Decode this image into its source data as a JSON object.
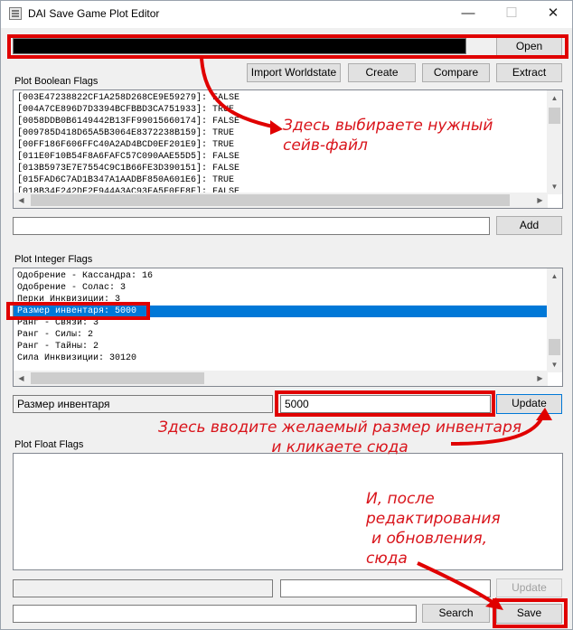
{
  "window": {
    "title": "DAI Save Game Plot Editor",
    "minimize": "—",
    "maximize": "☐",
    "close": "✕"
  },
  "file": {
    "path": "",
    "open_label": "Open"
  },
  "toolbar": {
    "import_label": "Import Worldstate",
    "create_label": "Create",
    "compare_label": "Compare",
    "extract_label": "Extract"
  },
  "boolean": {
    "label": "Plot Boolean Flags",
    "rows": [
      "[003E47238822CF1A258D268CE9E59279]: FALSE",
      "[004A7CE896D7D3394BCFBBD3CA751933]: TRUE",
      "[0058DDB0B6149442B13FF99015660174]: FALSE",
      "[009785D418D65A5B3064E8372238B159]: TRUE",
      "[00FF186F606FFC40A2AD4BCD0EF201E9]: TRUE",
      "[011E0F10B54F8A6FAFC57C090AAE55D5]: FALSE",
      "[013B5973E7E7554C9C1B66FE3D390151]: FALSE",
      "[015FAD6C7AD1B347A1AADBF850A601E6]: TRUE",
      "[018B34F242DF2E944A3AC93FA5F0FF8F]: FALSE"
    ],
    "input_value": "",
    "add_label": "Add"
  },
  "integer": {
    "label": "Plot Integer Flags",
    "rows": [
      "Одобрение - Кассандра: 16",
      "Одобрение - Солас: 3",
      "Перки Инквизиции: 3",
      "Размер инвентаря: 5000",
      "Ранг - Связи: 3",
      "Ранг - Силы: 2",
      "Ранг - Тайны: 2",
      "Сила Инквизиции: 30120"
    ],
    "selected_index": 3,
    "name_value": "Размер инвентаря",
    "value": "5000",
    "update_label": "Update"
  },
  "float": {
    "label": "Plot Float Flags",
    "name_value": "",
    "value": "",
    "update_label": "Update"
  },
  "bottom": {
    "search_value": "",
    "search_label": "Search",
    "save_label": "Save"
  },
  "annotations": {
    "file_note": [
      "Здесь выбираете нужный",
      "сейв-файл"
    ],
    "size_note": [
      "Здесь вводите желаемый размер инвентаря",
      "и кликаете сюда"
    ],
    "save_note": [
      "И, после",
      "редактирования",
      "и обновления,",
      "сюда"
    ]
  },
  "colors": {
    "highlight": "#e00000",
    "note_text": "#d9141b",
    "selection": "#0078d7"
  }
}
